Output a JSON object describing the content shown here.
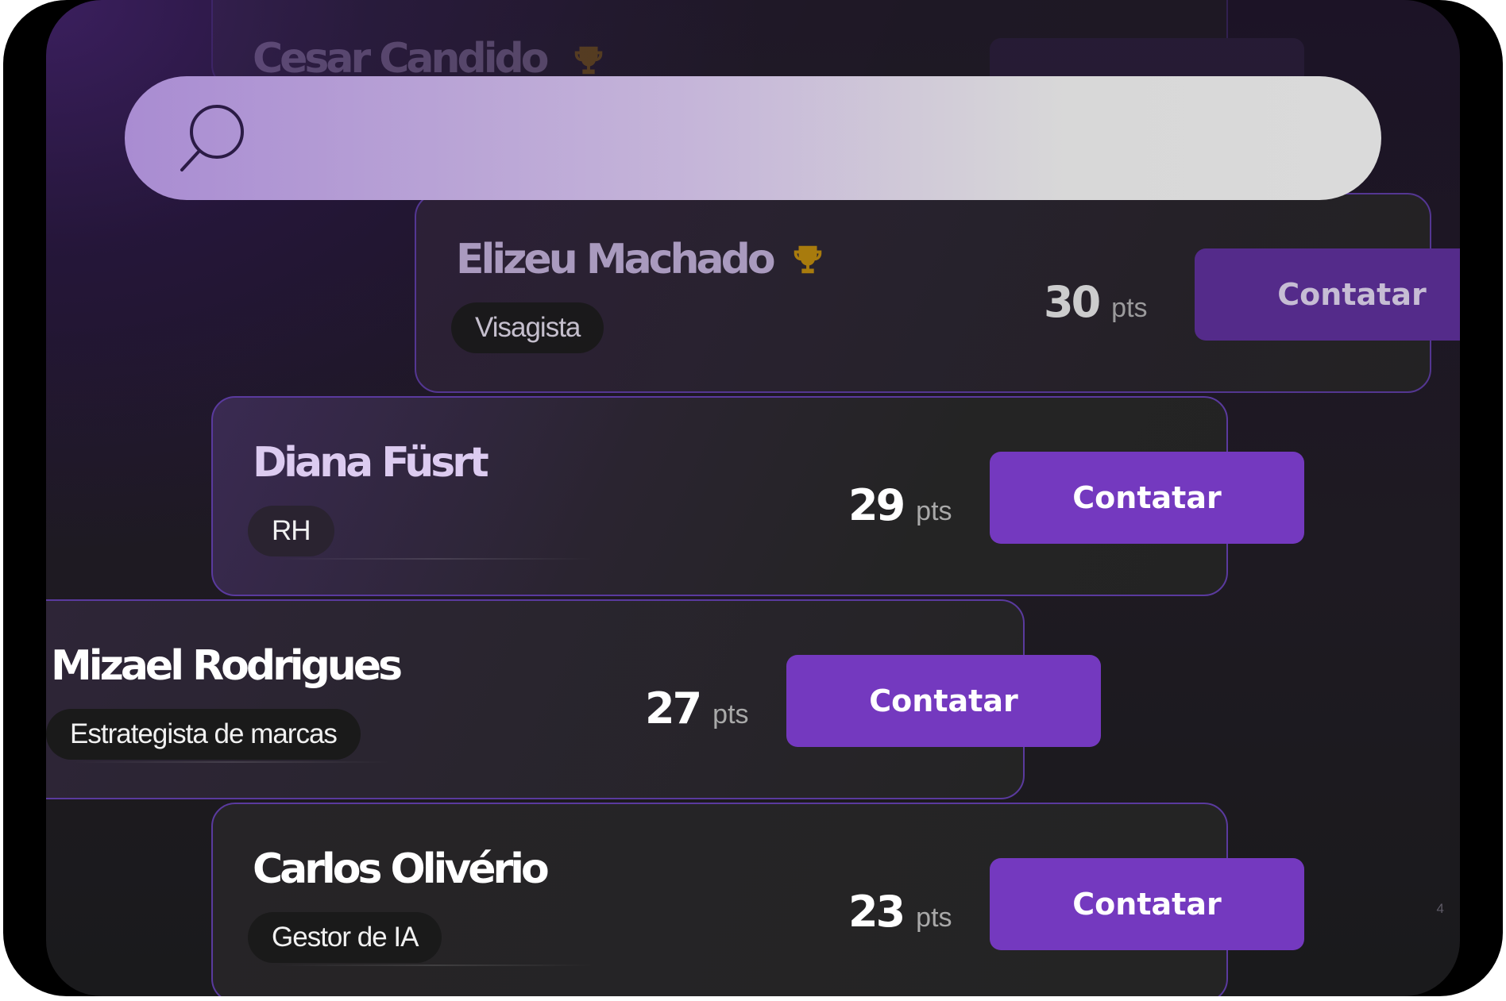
{
  "search": {
    "placeholder": "",
    "value": ""
  },
  "score_unit": "pts",
  "contact_label": "Contatar",
  "cards": [
    {
      "name": "Cesar Candido",
      "role": "",
      "score": "",
      "trophy": true
    },
    {
      "name": "Elizeu Machado",
      "role": "Visagista",
      "score": "30",
      "trophy": true
    },
    {
      "name": "Diana Füsrt",
      "role": "RH",
      "score": "29",
      "trophy": false
    },
    {
      "name": "Mizael Rodrigues",
      "role": "Estrategista de marcas",
      "score": "27",
      "trophy": false
    },
    {
      "name": "Carlos Olivério",
      "role": "Gestor de IA",
      "score": "23",
      "trophy": false
    }
  ],
  "page_number": "4",
  "colors": {
    "accent": "#7439bf",
    "card_border": "#5a3a9e",
    "trophy": "#b8860b",
    "background": "#1e1a22"
  }
}
